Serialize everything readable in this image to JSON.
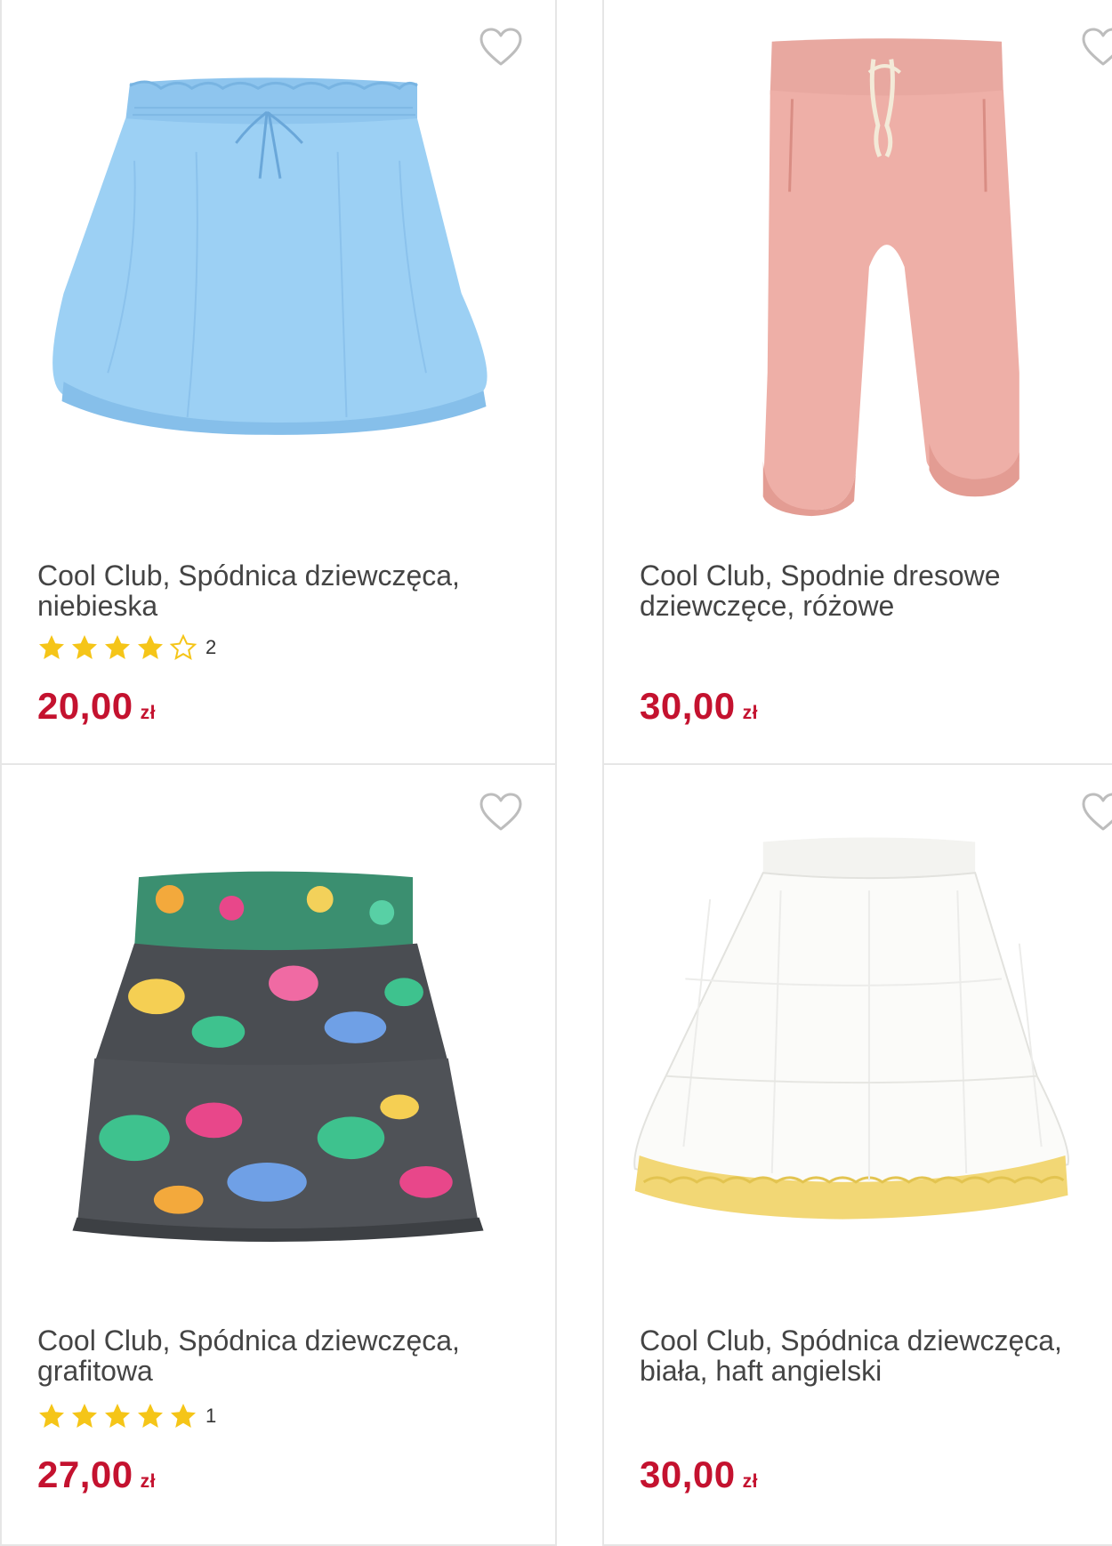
{
  "colors": {
    "price": "#c4122f",
    "star": "#f5c518",
    "border": "#e6e6e6",
    "heart": "#bdbdbd"
  },
  "products": [
    {
      "title": "Cool Club, Spódnica dziewczęca, niebieska",
      "title_line1": "Cool Club, Spódnica dziewczęca,",
      "title_line2": "niebieska",
      "rating": 4,
      "rating_count": "2",
      "price": "20,00",
      "currency": "zł",
      "image": "light-blue-skirt"
    },
    {
      "title": "Cool Club, Spodnie dresowe dziewczęce, różowe",
      "title_line1": "Cool Club, Spodnie dresowe",
      "title_line2": "dziewczęce, różowe",
      "price": "30,00",
      "currency": "zł",
      "image": "pink-sweatpants"
    },
    {
      "title": "Cool Club, Spódnica dziewczęca, grafitowa",
      "title_line1": "Cool Club, Spódnica dziewczęca,",
      "title_line2": "grafitowa",
      "rating": 5,
      "rating_count": "1",
      "price": "27,00",
      "currency": "zł",
      "image": "floral-tiered-skirt"
    },
    {
      "title": "Cool Club, Spódnica dziewczęca, biała, haft angielski",
      "title_line1": "Cool Club, Spódnica dziewczęca,",
      "title_line2": "biała, haft angielski",
      "price": "30,00",
      "currency": "zł",
      "image": "white-embroidered-skirt"
    }
  ]
}
